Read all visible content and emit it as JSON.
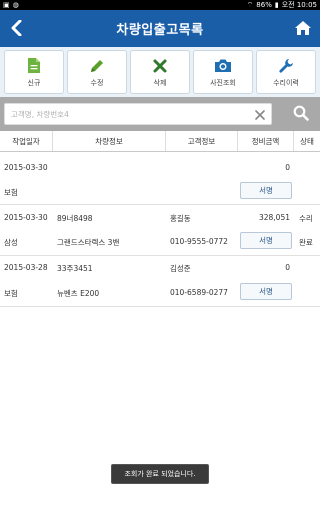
{
  "statusbar": {
    "battery": "86%",
    "time": "오전 10:05"
  },
  "titlebar": {
    "title": "차량입출고목록"
  },
  "toolbar": {
    "buttons": [
      {
        "label": "신규",
        "icon": "document-icon"
      },
      {
        "label": "수정",
        "icon": "pencil-icon"
      },
      {
        "label": "삭제",
        "icon": "x-delete-icon"
      },
      {
        "label": "사진조회",
        "icon": "camera-icon"
      },
      {
        "label": "수리이력",
        "icon": "wrench-icon"
      }
    ]
  },
  "search": {
    "placeholder": "고객명, 차량번호4",
    "value": ""
  },
  "table": {
    "headers": [
      "작업일자",
      "차량정보",
      "고객정보",
      "정비금액",
      "상태"
    ],
    "rows": [
      {
        "date": "2015-03-30",
        "car_no": "",
        "customer": "",
        "amount": "0",
        "status": "",
        "insurer": "보험",
        "car_model": "",
        "phone": "",
        "service_label": "서명",
        "status2": ""
      },
      {
        "date": "2015-03-30",
        "car_no": "89너8498",
        "customer": "홍길동",
        "amount": "328,051",
        "status": "수리",
        "insurer": "삼성",
        "car_model": "그랜드스타렉스 3밴",
        "phone": "010-9555-0772",
        "service_label": "서명",
        "status2": "완료"
      },
      {
        "date": "2015-03-28",
        "car_no": "33주3451",
        "customer": "김성준",
        "amount": "0",
        "status": "",
        "insurer": "보험",
        "car_model": "뉴벤츠 E200",
        "phone": "010-6589-0277",
        "service_label": "서명",
        "status2": ""
      }
    ]
  },
  "toast": {
    "message": "조회가 완료 되었습니다."
  },
  "colors": {
    "titlebar": "#1a5ea8",
    "toolbar_bg": "#eaf2f7",
    "search_bg": "#a9a9a9",
    "icon_green": "#5aa02c",
    "icon_blue": "#1f6fb5"
  }
}
